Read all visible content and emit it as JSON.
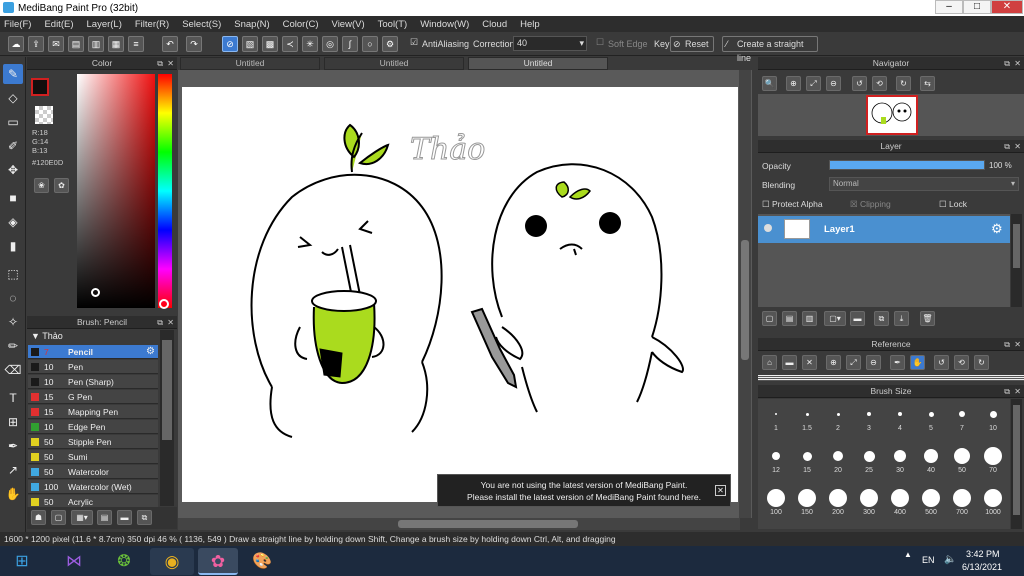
{
  "window": {
    "title": "MediBang Paint Pro (32bit)"
  },
  "menu": [
    "File(F)",
    "Edit(E)",
    "Layer(L)",
    "Filter(R)",
    "Select(S)",
    "Snap(N)",
    "Color(C)",
    "View(V)",
    "Tool(T)",
    "Window(W)",
    "Cloud",
    "Help"
  ],
  "toolbar": {
    "antialiasing": "AntiAliasing",
    "correction_label": "Correction",
    "correction_value": "40",
    "soft_edge": "Soft Edge",
    "key": "Key",
    "reset": "Reset",
    "straight_line": "Create a straight line"
  },
  "tabs": [
    "Untitled",
    "Untitled",
    "Untitled"
  ],
  "color_panel": {
    "title": "Color",
    "r": "R:18",
    "g": "G:14",
    "b": "B:13",
    "hex": "#120E0D",
    "current_color": "#120e0d"
  },
  "brush_panel": {
    "title": "Brush: Pencil",
    "group": "Thảo",
    "items": [
      {
        "size": "7",
        "name": "Pencil",
        "color": "#1a1a1a"
      },
      {
        "size": "10",
        "name": "Pen",
        "color": "#1a1a1a"
      },
      {
        "size": "10",
        "name": "Pen (Sharp)",
        "color": "#1a1a1a"
      },
      {
        "size": "15",
        "name": "G Pen",
        "color": "#e03030"
      },
      {
        "size": "15",
        "name": "Mapping Pen",
        "color": "#e03030"
      },
      {
        "size": "10",
        "name": "Edge Pen",
        "color": "#30a030"
      },
      {
        "size": "50",
        "name": "Stipple Pen",
        "color": "#e0d020"
      },
      {
        "size": "50",
        "name": "Sumi",
        "color": "#e0d020"
      },
      {
        "size": "50",
        "name": "Watercolor",
        "color": "#40a8e0"
      },
      {
        "size": "100",
        "name": "Watercolor (Wet)",
        "color": "#40a8e0"
      },
      {
        "size": "50",
        "name": "Acrylic",
        "color": "#e0d020"
      }
    ]
  },
  "navigator": {
    "title": "Navigator"
  },
  "layer_panel": {
    "title": "Layer",
    "opacity_label": "Opacity",
    "opacity_value": "100 %",
    "opacity_level": 1.0,
    "blending_label": "Blending",
    "blending_value": "Normal",
    "protect_alpha": "Protect Alpha",
    "clipping": "Clipping",
    "lock": "Lock",
    "layer_name": "Layer1"
  },
  "reference": {
    "title": "Reference"
  },
  "brush_size": {
    "title": "Brush Size",
    "sizes": [
      "1",
      "1.5",
      "2",
      "3",
      "4",
      "5",
      "7",
      "10",
      "12",
      "15",
      "20",
      "25",
      "30",
      "40",
      "50",
      "70",
      "100",
      "150",
      "200",
      "300",
      "400",
      "500",
      "700",
      "1000"
    ]
  },
  "canvas": {
    "signature": "Thảo"
  },
  "notice": {
    "line1": "You are not using the latest version of MediBang Paint.",
    "line2": "Please install the latest version of MediBang Paint found here."
  },
  "status": {
    "text": "1600 * 1200 pixel   (11.6 * 8.7cm)   350 dpi   46 %   ( 1136, 549 )   Draw a straight line by holding down Shift, Change a brush size by holding down Ctrl, Alt, and dragging"
  },
  "taskbar": {
    "lang": "EN",
    "time": "3:42 PM",
    "date": "6/13/2021"
  }
}
